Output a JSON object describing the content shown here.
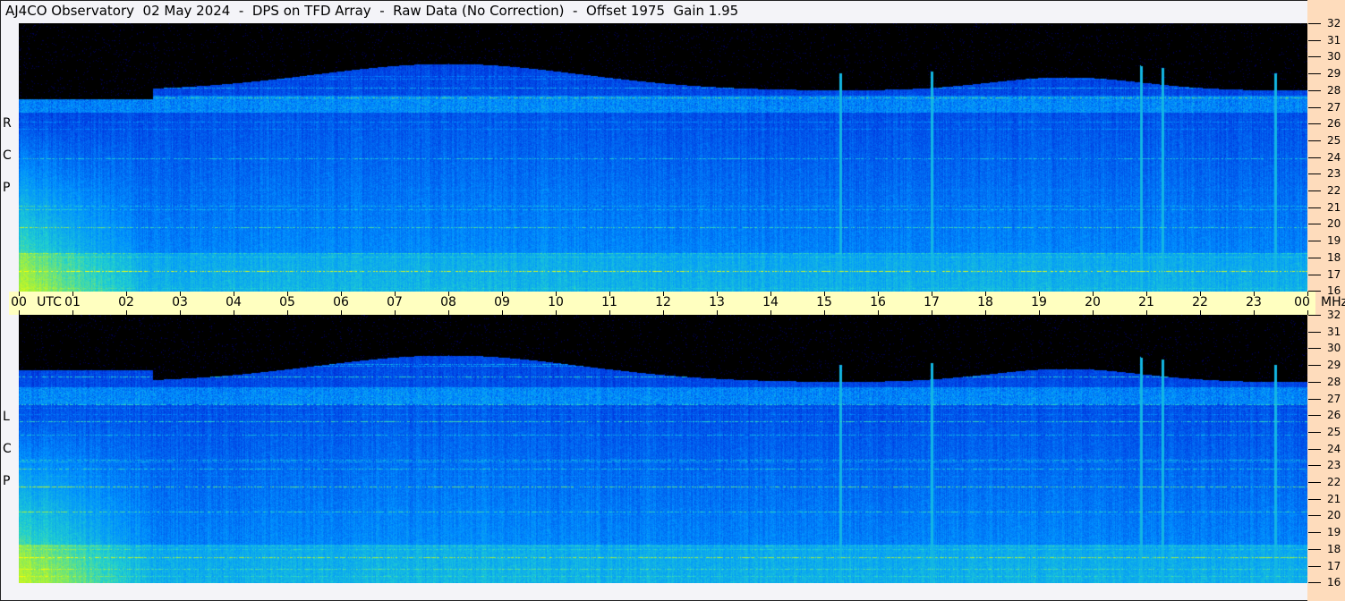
{
  "title": "AJ4CO Observatory  02 May 2024  -  DPS on TFD Array  -  Raw Data (No Correction)  -  Offset 1975  Gain 1.95",
  "chart_data": {
    "type": "heatmap",
    "panels": [
      {
        "name": "R C P",
        "letters": [
          "R",
          "C",
          "P"
        ]
      },
      {
        "name": "L C P",
        "letters": [
          "L",
          "C",
          "P"
        ]
      }
    ],
    "x_axis": {
      "label": "UTC",
      "tick_labels": [
        "00",
        "01",
        "02",
        "03",
        "04",
        "05",
        "06",
        "07",
        "08",
        "09",
        "10",
        "11",
        "12",
        "13",
        "14",
        "15",
        "16",
        "17",
        "18",
        "19",
        "20",
        "21",
        "22",
        "23",
        "00"
      ],
      "range_hours": [
        0,
        24
      ]
    },
    "y_axis": {
      "unit": "MHz",
      "tick_labels": [
        "32",
        "31",
        "30",
        "29",
        "28",
        "27",
        "26",
        "25",
        "24",
        "23",
        "22",
        "21",
        "20",
        "19",
        "18",
        "17",
        "16"
      ],
      "range": [
        16,
        32
      ]
    },
    "colormap": [
      "#000000",
      "#00007a",
      "#0038e0",
      "#0090ff",
      "#20d0d0",
      "#a0f040",
      "#ffff00",
      "#ff40ff"
    ],
    "vertical_interference_hours": [
      15.3,
      17.0,
      20.9,
      21.3,
      23.4
    ]
  }
}
